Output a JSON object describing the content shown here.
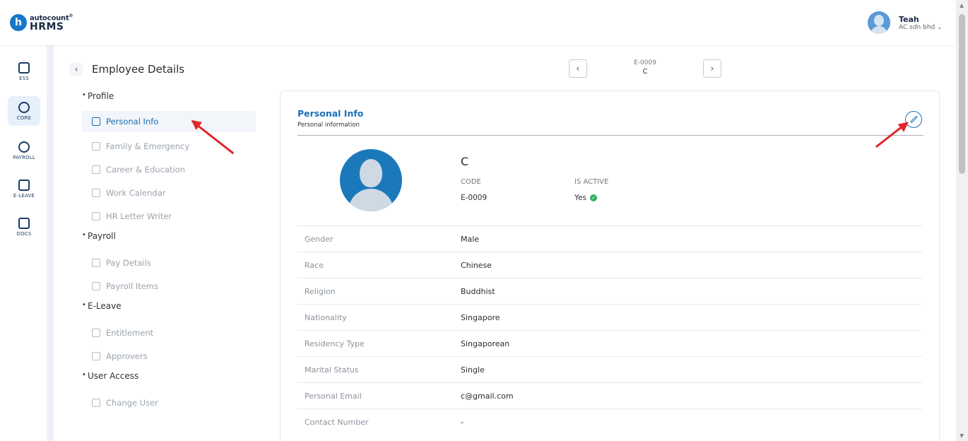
{
  "header": {
    "logo_top": "autocount",
    "logo_reg": "®",
    "logo_bottom": "HRMS",
    "logo_badge": "h",
    "user_name": "Teah",
    "user_company": "AC sdn bhd ⌄"
  },
  "rail": {
    "items": [
      {
        "label": "ESS",
        "icon": "ess-icon"
      },
      {
        "label": "CORE",
        "icon": "cube-icon",
        "active": true
      },
      {
        "label": "PAYROLL",
        "icon": "dollar-icon"
      },
      {
        "label": "E-LEAVE",
        "icon": "calendar-icon"
      },
      {
        "label": "DOCS",
        "icon": "document-icon"
      }
    ]
  },
  "page": {
    "title": "Employee Details",
    "back_glyph": "‹"
  },
  "navigator": {
    "code": "E-0009",
    "name": "C",
    "prev_glyph": "‹",
    "next_glyph": "›"
  },
  "menu": {
    "profile": "Profile",
    "personal_info": "Personal Info",
    "family_emergency": "Family & Emergency",
    "career_education": "Career & Education",
    "work_calendar": "Work Calendar",
    "hr_letter_writer": "HR Letter Writer",
    "payroll": "Payroll",
    "pay_details": "Pay Details",
    "payroll_items": "Payroll Items",
    "eleave": "E-Leave",
    "entitlement": "Entitlement",
    "approvers": "Approvers",
    "user_access": "User Access",
    "change_user": "Change User"
  },
  "card": {
    "title": "Personal Info",
    "subtitle": "Personal information",
    "employee_name": "C",
    "code_label": "CODE",
    "code_value": "E-0009",
    "active_label": "IS ACTIVE",
    "active_value": "Yes",
    "check_glyph": "✓",
    "fields": [
      {
        "label": "Gender",
        "value": "Male"
      },
      {
        "label": "Race",
        "value": "Chinese"
      },
      {
        "label": "Religion",
        "value": "Buddhist"
      },
      {
        "label": "Nationality",
        "value": "Singapore"
      },
      {
        "label": "Residency Type",
        "value": "Singaporean"
      },
      {
        "label": "Marital Status",
        "value": "Single"
      },
      {
        "label": "Personal Email",
        "value": "c@gmail.com"
      },
      {
        "label": "Contact Number",
        "value": "-"
      }
    ]
  },
  "colors": {
    "accent": "#1b6fb7",
    "annotation": "#e0252b",
    "active_check": "#2fb35b"
  }
}
